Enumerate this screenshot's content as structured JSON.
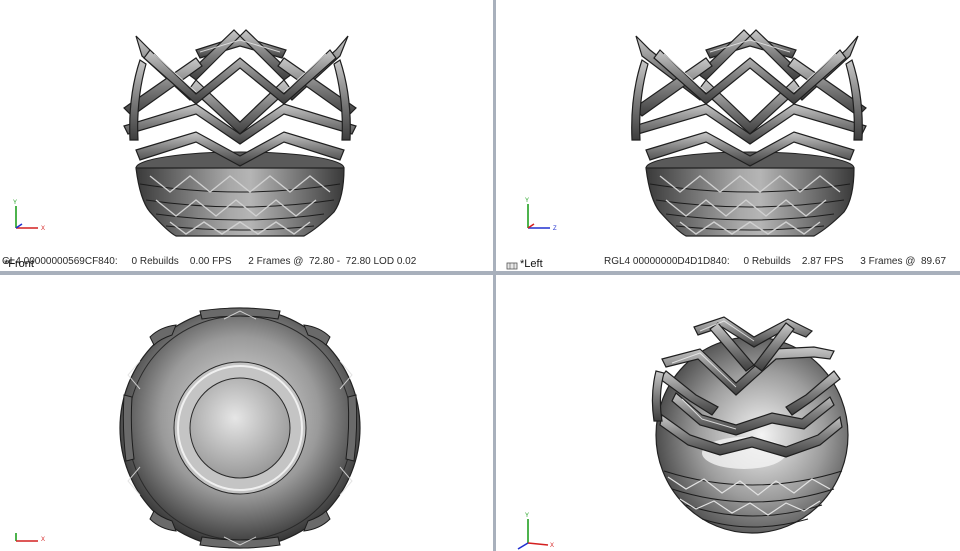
{
  "viewports": {
    "front": {
      "view_name": "*Front",
      "stats_text": "GL4 00000000569CF840:     0 Rebuilds    0.00 FPS      2 Frames @  72.80 -  72.80 LOD 0.02",
      "triad": {
        "up": "Y",
        "side": "X"
      }
    },
    "left": {
      "view_name": "*Left",
      "stats_text": "RGL4 00000000D4D1D840:     0 Rebuilds    2.87 FPS      3 Frames @  89.67",
      "triad": {
        "up": "Y",
        "side": "Z"
      }
    },
    "top": {
      "triad": {
        "up": "",
        "side": "X"
      }
    },
    "iso": {
      "triad": {
        "up": "Y",
        "side": "X"
      }
    }
  },
  "icons": [
    "view-cube-icon",
    "axis-triad-icon"
  ],
  "colors": {
    "background": "#ffffff",
    "divider": "#a8b0bc",
    "axis_x": "#d42020",
    "axis_y": "#20a020",
    "axis_z": "#2030d0",
    "model_dark": "#3a3a3a",
    "model_light": "#d8d8d8"
  }
}
